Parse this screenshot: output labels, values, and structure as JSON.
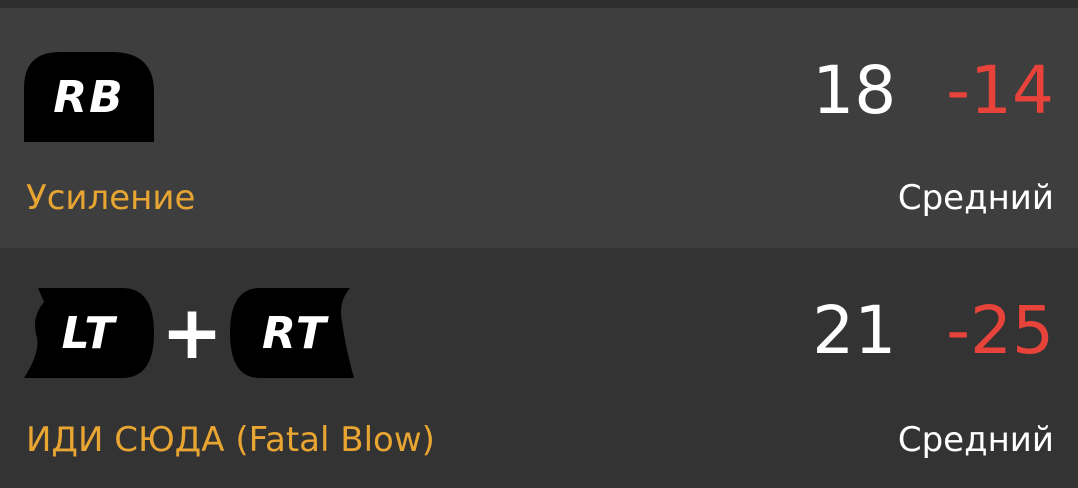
{
  "moves": [
    {
      "buttons": [
        {
          "label": "RB",
          "icon": "rb-button-icon"
        }
      ],
      "startup": "18",
      "advantage": "-14",
      "name": "Усиление",
      "block_type": "Средний"
    },
    {
      "buttons": [
        {
          "label": "LT",
          "icon": "lt-button-icon"
        },
        {
          "label": "RT",
          "icon": "rt-button-icon"
        }
      ],
      "combo_separator": "+",
      "startup": "21",
      "advantage": "-25",
      "name": "ИДИ СЮДА (Fatal Blow)",
      "block_type": "Средний"
    }
  ],
  "colors": {
    "row_light": "#3e3e3e",
    "row_dark": "#333333",
    "move_name": "#e8a532",
    "advantage_negative": "#e8433a",
    "text": "#ffffff",
    "badge": "#000000"
  }
}
